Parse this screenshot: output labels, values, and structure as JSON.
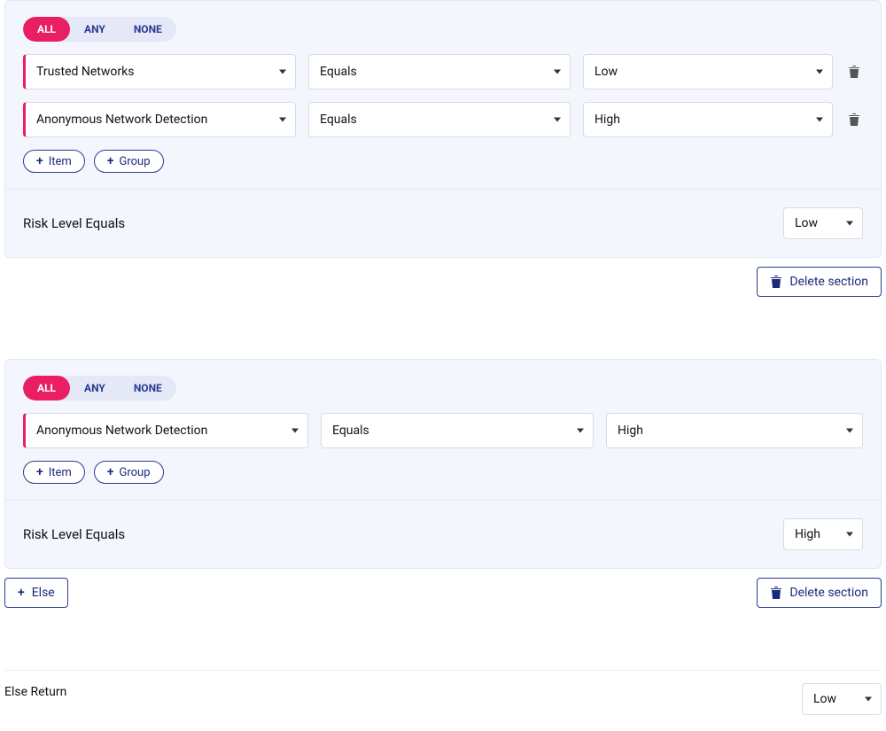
{
  "logic": {
    "all": "ALL",
    "any": "ANY",
    "none": "NONE"
  },
  "buttons": {
    "item": "Item",
    "group": "Group",
    "else": "Else",
    "delete_section": "Delete section"
  },
  "result_label": "Risk Level Equals",
  "sections": [
    {
      "rows": [
        {
          "field": "Trusted Networks",
          "op": "Equals",
          "val": "Low",
          "deletable": true
        },
        {
          "field": "Anonymous Network Detection",
          "op": "Equals",
          "val": "High",
          "deletable": true
        }
      ],
      "result_value": "Low",
      "show_else_button": false
    },
    {
      "rows": [
        {
          "field": "Anonymous Network Detection",
          "op": "Equals",
          "val": "High",
          "deletable": false
        }
      ],
      "result_value": "High",
      "show_else_button": true
    }
  ],
  "else_return": {
    "label": "Else Return",
    "value": "Low"
  }
}
